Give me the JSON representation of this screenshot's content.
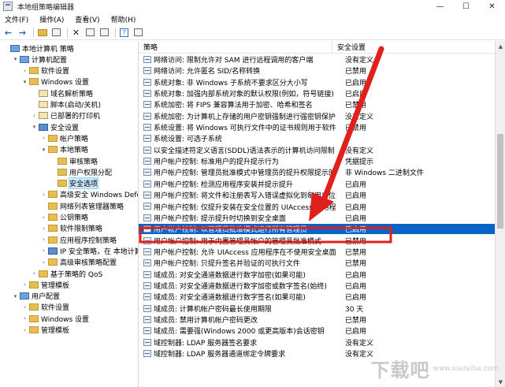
{
  "window": {
    "title": "本地组策略编辑器",
    "minimize": "—",
    "maximize": "☐",
    "close": "✕"
  },
  "menu": [
    "文件(F)",
    "操作(A)",
    "查看(V)",
    "帮助(H)"
  ],
  "tree": [
    {
      "label": "本地计算机 策略",
      "level": 0,
      "toggle": "",
      "icon": "computer"
    },
    {
      "label": "计算机配置",
      "level": 1,
      "toggle": "▾",
      "icon": "computer"
    },
    {
      "label": "软件设置",
      "level": 2,
      "toggle": "›",
      "icon": "folder"
    },
    {
      "label": "Windows 设置",
      "level": 2,
      "toggle": "▾",
      "icon": "folder"
    },
    {
      "label": "域名解析策略",
      "level": 3,
      "toggle": "",
      "icon": "policy"
    },
    {
      "label": "脚本(启动/关机)",
      "level": 3,
      "toggle": "",
      "icon": "policy"
    },
    {
      "label": "已部署的打印机",
      "level": 3,
      "toggle": "›",
      "icon": "policy"
    },
    {
      "label": "安全设置",
      "level": 3,
      "toggle": "▾",
      "icon": "shield"
    },
    {
      "label": "帐户策略",
      "level": 4,
      "toggle": "›",
      "icon": "folder"
    },
    {
      "label": "本地策略",
      "level": 4,
      "toggle": "▾",
      "icon": "folder"
    },
    {
      "label": "审核策略",
      "level": 5,
      "toggle": "",
      "icon": "folder"
    },
    {
      "label": "用户权限分配",
      "level": 5,
      "toggle": "",
      "icon": "folder"
    },
    {
      "label": "安全选项",
      "level": 5,
      "toggle": "",
      "icon": "folder",
      "selected": true
    },
    {
      "label": "高级安全 Windows Defende",
      "level": 4,
      "toggle": "›",
      "icon": "folder"
    },
    {
      "label": "网络列表管理器策略",
      "level": 4,
      "toggle": "",
      "icon": "folder"
    },
    {
      "label": "公钥策略",
      "level": 4,
      "toggle": "›",
      "icon": "folder"
    },
    {
      "label": "软件限制策略",
      "level": 4,
      "toggle": "›",
      "icon": "folder"
    },
    {
      "label": "应用程序控制策略",
      "level": 4,
      "toggle": "›",
      "icon": "folder"
    },
    {
      "label": "IP 安全策略，在 本地计算机",
      "level": 4,
      "toggle": "›",
      "icon": "shield"
    },
    {
      "label": "高级审核策略配置",
      "level": 4,
      "toggle": "›",
      "icon": "folder"
    },
    {
      "label": "基于策略的 QoS",
      "level": 3,
      "toggle": "›",
      "icon": "folder"
    },
    {
      "label": "管理模板",
      "level": 2,
      "toggle": "›",
      "icon": "folder"
    },
    {
      "label": "用户配置",
      "level": 1,
      "toggle": "▾",
      "icon": "computer"
    },
    {
      "label": "软件设置",
      "level": 2,
      "toggle": "›",
      "icon": "folder"
    },
    {
      "label": "Windows 设置",
      "level": 2,
      "toggle": "›",
      "icon": "folder"
    },
    {
      "label": "管理模板",
      "level": 2,
      "toggle": "›",
      "icon": "folder"
    }
  ],
  "list": {
    "header_policy": "策略",
    "header_setting": "安全设置",
    "rows": [
      {
        "name": "网络访问: 限制允许对 SAM 进行远程调用的客户端",
        "value": "没有定义"
      },
      {
        "name": "网络访问: 允许匿名 SID/名称转换",
        "value": "已禁用"
      },
      {
        "name": "系统对象: 非 Windows 子系统不要求区分大小写",
        "value": "已启用"
      },
      {
        "name": "系统对象: 加强内部系统对象的默认权限(例如，符号链接)",
        "value": "已启用"
      },
      {
        "name": "系统加密: 将 FIPS 兼容算法用于加密、哈希和签名",
        "value": "已禁用"
      },
      {
        "name": "系统加密: 为计算机上存储的用户密钥强制进行强密钥保护",
        "value": "没有定义"
      },
      {
        "name": "系统设置: 将 Windows 可执行文件中的证书规则用于软件...",
        "value": "已禁用"
      },
      {
        "name": "系统设置: 可选子系统",
        "value": ""
      },
      {
        "name": "以安全描述符定义语言(SDDL)语法表示的计算机访问限制",
        "value": "没有定义"
      },
      {
        "name": "用户帐户控制: 标准用户的提升提示行为",
        "value": "凭据提示"
      },
      {
        "name": "用户帐户控制: 管理员批准模式中管理员的提升权限提示的...",
        "value": "非 Windows 二进制文件"
      },
      {
        "name": "用户帐户控制: 检测应用程序安装并提示提升",
        "value": "已启用"
      },
      {
        "name": "用户帐户控制: 将文件和注册表写入错误虚拟化到每用户位置",
        "value": "已启用"
      },
      {
        "name": "用户帐户控制: 仅提升安装在安全位置的 UIAccess 应用程序",
        "value": "已启用"
      },
      {
        "name": "用户帐户控制: 提示提升时切换到安全桌面",
        "value": "已启用"
      },
      {
        "name": "用户帐户控制: 以管理员批准模式运行所有管理员",
        "value": "已启用",
        "highlight": true
      },
      {
        "name": "用户帐户控制: 用于内置管理员帐户的管理员批准模式",
        "value": "已禁用"
      },
      {
        "name": "用户帐户控制: 允许 UIAccess 应用程序在不使用安全桌面...",
        "value": "已禁用"
      },
      {
        "name": "用户帐户控制: 只提升签名并验证的可执行文件",
        "value": "已禁用"
      },
      {
        "name": "域成员: 对安全通道数据进行数字加密(如果可能)",
        "value": "已启用"
      },
      {
        "name": "域成员: 对安全通道数据进行数字加密或数字签名(始终)",
        "value": "已启用"
      },
      {
        "name": "域成员: 对安全通道数据进行数字签名(如果可能)",
        "value": "已启用"
      },
      {
        "name": "域成员: 计算机帐户密码最长使用期限",
        "value": "30 天"
      },
      {
        "name": "域成员: 禁用计算机帐户密码更改",
        "value": "已禁用"
      },
      {
        "name": "域成员: 需要强(Windows 2000 或更高版本)会话密钥",
        "value": "已启用"
      },
      {
        "name": "域控制器: LDAP 服务器签名要求",
        "value": "没有定义"
      },
      {
        "name": "域控制器: LDAP 服务器通道绑定令牌要求",
        "value": "没有定义"
      }
    ]
  },
  "colors": {
    "selection": "#0a63c6",
    "annotation": "#e0201b",
    "tree_selected": "#cce8ff"
  },
  "watermark": {
    "logo": "下载吧",
    "url": "www.xiazaiba.com"
  }
}
